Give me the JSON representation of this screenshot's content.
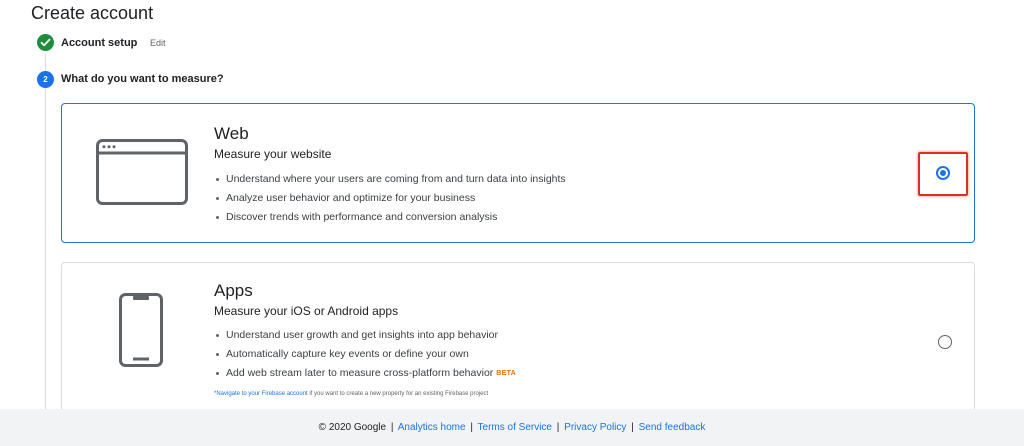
{
  "page": {
    "title": "Create account"
  },
  "steps": {
    "step1": {
      "title": "Account setup",
      "edit_label": "Edit"
    },
    "step2": {
      "number": "2",
      "title": "What do you want to measure?"
    }
  },
  "options": {
    "web": {
      "title": "Web",
      "subtitle": "Measure your website",
      "bullets": [
        "Understand where your users are coming from and turn data into insights",
        "Analyze user behavior and optimize for your business",
        "Discover trends with performance and conversion analysis"
      ],
      "selected": true
    },
    "apps": {
      "title": "Apps",
      "subtitle": "Measure your iOS or Android apps",
      "bullets": [
        "Understand user growth and get insights into app behavior",
        "Automatically capture key events or define your own",
        "Add web stream later to measure cross-platform behavior"
      ],
      "beta_label": "BETA",
      "note_link": "*Navigate to your Firebase account",
      "note_text": " if you want to create a new property for an existing Firebase project",
      "selected": false
    }
  },
  "footer": {
    "copyright": "© 2020 Google",
    "separator": "|",
    "links": [
      "Analytics home",
      "Terms of Service",
      "Privacy Policy",
      "Send feedback"
    ]
  },
  "colors": {
    "accent": "#1a73e8",
    "success": "#1e8e3e",
    "highlight": "#d93025",
    "beta": "#e37400"
  },
  "icons": {
    "step1": "check-icon",
    "web": "browser-window-icon",
    "apps": "smartphone-icon"
  }
}
